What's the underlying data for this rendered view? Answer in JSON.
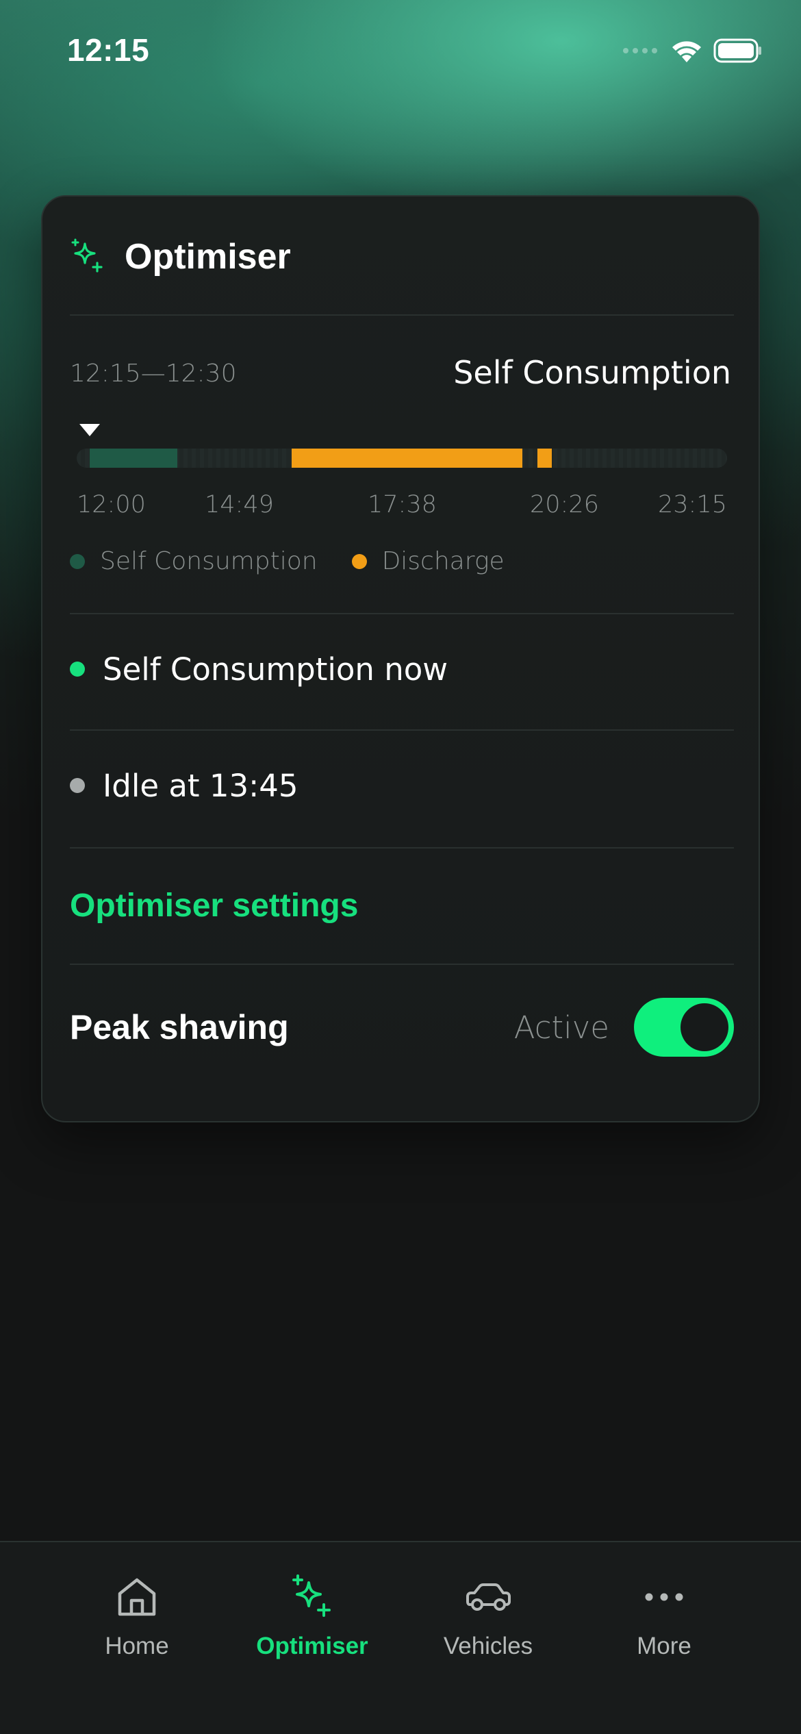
{
  "status_bar": {
    "time": "12:15"
  },
  "card": {
    "title": "Optimiser",
    "slot": {
      "time_range": "12:15—12:30",
      "mode": "Self Consumption"
    },
    "timeline": {
      "start_time": "12:00",
      "end_time": "23:15",
      "segments": [
        {
          "mode": "Self Consumption",
          "start_fraction": 0.02,
          "end_fraction": 0.155,
          "color": "#1f5a46"
        },
        {
          "mode": "Discharge",
          "start_fraction": 0.331,
          "end_fraction": 0.686,
          "color": "#f29e16"
        },
        {
          "mode": "Discharge",
          "start_fraction": 0.708,
          "end_fraction": 0.73,
          "color": "#f29e16"
        }
      ],
      "ticks": [
        "12:00",
        "14:49",
        "17:38",
        "20:26",
        "23:15"
      ]
    },
    "legend": [
      {
        "label": "Self Consumption",
        "color": "#1f5a46"
      },
      {
        "label": "Discharge",
        "color": "#f29e16"
      }
    ],
    "current_status": {
      "text": "Self Consumption now",
      "dot_color": "#17e07e"
    },
    "next_status": {
      "text": "Idle at 13:45",
      "dot_color": "#a7abab"
    },
    "settings_link": "Optimiser settings",
    "peak_shaving": {
      "label": "Peak shaving",
      "status": "Active",
      "enabled": true
    }
  },
  "nav": {
    "items": [
      {
        "label": "Home",
        "icon": "home-icon",
        "active": false
      },
      {
        "label": "Optimiser",
        "icon": "sparkles-icon",
        "active": true
      },
      {
        "label": "Vehicles",
        "icon": "car-icon",
        "active": false
      },
      {
        "label": "More",
        "icon": "more-icon",
        "active": false
      }
    ]
  },
  "colors": {
    "accent": "#17e07e",
    "discharge": "#f29e16",
    "self_consumption": "#1f5a46"
  }
}
